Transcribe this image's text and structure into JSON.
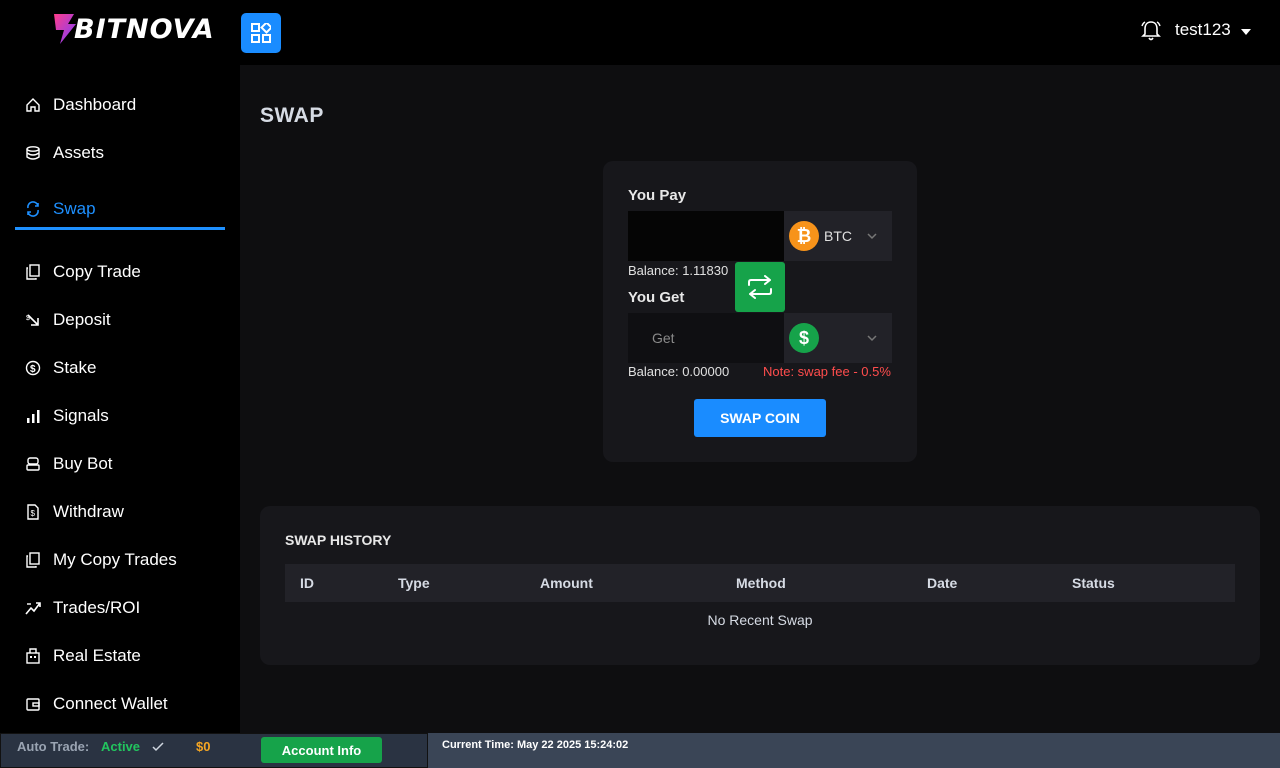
{
  "brand": {
    "name": "BITNOVA"
  },
  "topbar": {
    "user": "test123"
  },
  "sidebar": {
    "items": [
      {
        "label": "Dashboard",
        "icon": "home-icon"
      },
      {
        "label": "Assets",
        "icon": "database-icon"
      },
      {
        "label": "Swap",
        "icon": "swap-icon",
        "active": true
      },
      {
        "label": "Copy Trade",
        "icon": "copy-icon"
      },
      {
        "label": "Deposit",
        "icon": "deposit-arrow-icon"
      },
      {
        "label": "Stake",
        "icon": "dollar-circle-icon"
      },
      {
        "label": "Signals",
        "icon": "bar-chart-icon"
      },
      {
        "label": "Buy Bot",
        "icon": "bot-icon"
      },
      {
        "label": "Withdraw",
        "icon": "withdraw-file-icon"
      },
      {
        "label": "My Copy Trades",
        "icon": "copy-icon"
      },
      {
        "label": "Trades/ROI",
        "icon": "trend-icon"
      },
      {
        "label": "Real Estate",
        "icon": "building-icon"
      },
      {
        "label": "Connect Wallet",
        "icon": "wallet-icon"
      }
    ]
  },
  "main": {
    "title": "SWAP",
    "swap": {
      "pay_label": "You Pay",
      "pay_value": "",
      "pay_coin": "BTC",
      "pay_balance": "Balance: 1.11830",
      "get_label": "You Get",
      "get_placeholder": "Get",
      "get_coin": "",
      "get_balance": "Balance: 0.00000",
      "note": "Note: swap fee - 0.5%",
      "submit_label": "SWAP COIN"
    },
    "history": {
      "title": "SWAP HISTORY",
      "columns": [
        "ID",
        "Type",
        "Amount",
        "Method",
        "Date",
        "Status"
      ],
      "empty_text": "No Recent Swap"
    }
  },
  "footer": {
    "auto_trade_label": "Auto Trade:",
    "auto_trade_status": "Active",
    "balance": "$0",
    "account_button": "Account Info",
    "current_time": "Current Time: May 22 2025 15:24:02"
  },
  "colors": {
    "accent": "#1a8cff",
    "success": "#16a34a",
    "btc": "#f7931a",
    "warning_text": "#ff4d4d",
    "amount": "#f5a623"
  }
}
